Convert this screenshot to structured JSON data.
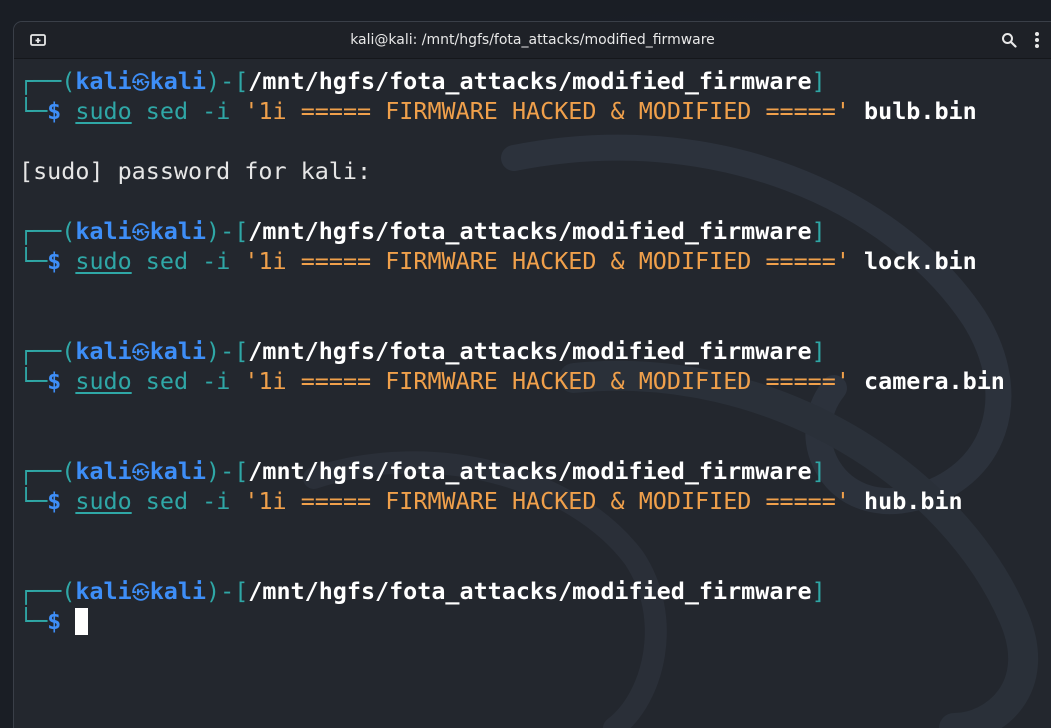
{
  "window": {
    "title": "kali@kali: /mnt/hgfs/fota_attacks/modified_firmware",
    "icons": {
      "new_tab": "new-tab-icon",
      "search": "search-icon",
      "menu": "kebab-menu-icon"
    }
  },
  "prompt": {
    "user": "kali",
    "host": "kali",
    "path": "/mnt/hgfs/fota_attacks/modified_firmware",
    "symbol": "$"
  },
  "terminal": {
    "blocks": [
      {
        "command": "sudo",
        "args": "sed -i",
        "string": "'1i ===== FIRMWARE HACKED & MODIFIED ====='",
        "file": "bulb.bin",
        "output": "[sudo] password for kali:"
      },
      {
        "command": "sudo",
        "args": "sed -i",
        "string": "'1i ===== FIRMWARE HACKED & MODIFIED ====='",
        "file": "lock.bin"
      },
      {
        "command": "sudo",
        "args": "sed -i",
        "string": "'1i ===== FIRMWARE HACKED & MODIFIED ====='",
        "file": "camera.bin"
      },
      {
        "command": "sudo",
        "args": "sed -i",
        "string": "'1i ===== FIRMWARE HACKED & MODIFIED ====='",
        "file": "hub.bin"
      }
    ]
  },
  "colors": {
    "background": "#23272e",
    "frame": "#2fa7a6",
    "user": "#3e8ef7",
    "string": "#f0a04b",
    "text": "#ffffff"
  }
}
